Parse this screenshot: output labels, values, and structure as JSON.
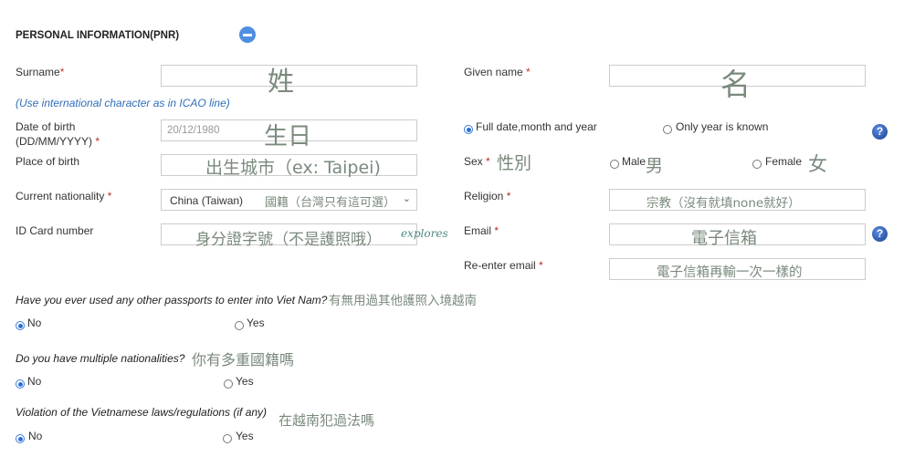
{
  "section": {
    "title": "PERSONAL INFORMATION(PNR)",
    "collapse_icon": "minus-circle-icon"
  },
  "surname": {
    "label": "Surname",
    "required": "*",
    "overlay": "姓",
    "value": ""
  },
  "given_name": {
    "label": "Given name",
    "required": "*",
    "overlay": "名",
    "value": ""
  },
  "icao_hint": "(Use international character as in ICAO line)",
  "dob": {
    "label_line1": "Date of birth",
    "label_line2": "(DD/MM/YYYY)",
    "required": "*",
    "placeholder": "20/12/1980",
    "overlay": "生日",
    "options": [
      {
        "label": "Full date,month and year",
        "selected": true
      },
      {
        "label": "Only year is known",
        "selected": false
      }
    ],
    "help_icon": "?"
  },
  "place_of_birth": {
    "label": "Place of birth",
    "overlay": "出生城市（ex: Taipei)"
  },
  "sex": {
    "label": "Sex",
    "required": "*",
    "overlay": "性別",
    "options": [
      {
        "label": "Male",
        "overlay": "男",
        "selected": false
      },
      {
        "label": "Female",
        "overlay": "女",
        "selected": false
      }
    ]
  },
  "nationality": {
    "label": "Current nationality",
    "required": "*",
    "value": "China (Taiwan)",
    "overlay": "國籍（台灣只有這可選）",
    "chevron": "⌄"
  },
  "religion": {
    "label": "Religion",
    "required": "*",
    "overlay": "宗教（沒有就填none就好）"
  },
  "id_card": {
    "label": "ID Card number",
    "overlay": "身分證字號（不是護照哦）"
  },
  "watermark": "explores",
  "email": {
    "label": "Email",
    "required": "*",
    "overlay": "電子信箱",
    "help_icon": "?"
  },
  "reenter_email": {
    "label": "Re-enter email",
    "required": "*",
    "overlay": "電子信箱再輸一次一樣的"
  },
  "questions": [
    {
      "text": "Have you ever used any other passports to enter into Viet Nam?",
      "overlay": "有無用過其他護照入境越南",
      "no": "No",
      "yes": "Yes",
      "selected": "No"
    },
    {
      "text": "Do you have multiple nationalities?",
      "overlay": "你有多重國籍嗎",
      "no": "No",
      "yes": "Yes",
      "selected": "No"
    },
    {
      "text": "Violation of the Vietnamese laws/regulations (if any)",
      "overlay": "在越南犯過法嗎",
      "no": "No",
      "yes": "Yes",
      "selected": "No"
    }
  ]
}
